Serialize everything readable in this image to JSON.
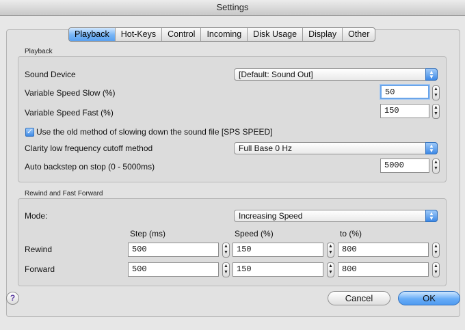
{
  "window": {
    "title": "Settings"
  },
  "tabs": [
    {
      "label": "Playback"
    },
    {
      "label": "Hot-Keys"
    },
    {
      "label": "Control"
    },
    {
      "label": "Incoming"
    },
    {
      "label": "Disk Usage"
    },
    {
      "label": "Display"
    },
    {
      "label": "Other"
    }
  ],
  "playback": {
    "title": "Playback",
    "sound_device": {
      "label": "Sound Device",
      "value": "[Default: Sound Out]"
    },
    "var_slow": {
      "label": "Variable Speed Slow (%)",
      "value": "50"
    },
    "var_fast": {
      "label": "Variable Speed Fast (%)",
      "value": "150"
    },
    "old_method": {
      "label": "Use the old method of slowing down the sound file [SPS SPEED]",
      "checked": true
    },
    "clarity": {
      "label": "Clarity low frequency cutoff method",
      "value": "Full Base 0 Hz"
    },
    "auto_backstep": {
      "label": "Auto backstep on stop (0 - 5000ms)",
      "value": "5000"
    }
  },
  "rewind_ff": {
    "title": "Rewind and Fast Forward",
    "mode": {
      "label": "Mode:",
      "value": "Increasing Speed"
    },
    "headers": {
      "step": "Step (ms)",
      "speed": "Speed (%)",
      "to": "to (%)"
    },
    "rewind": {
      "label": "Rewind",
      "step": "500",
      "speed": "150",
      "to": "800"
    },
    "forward": {
      "label": "Forward",
      "step": "500",
      "speed": "150",
      "to": "800"
    }
  },
  "footer": {
    "help": "?",
    "cancel": "Cancel",
    "ok": "OK"
  }
}
